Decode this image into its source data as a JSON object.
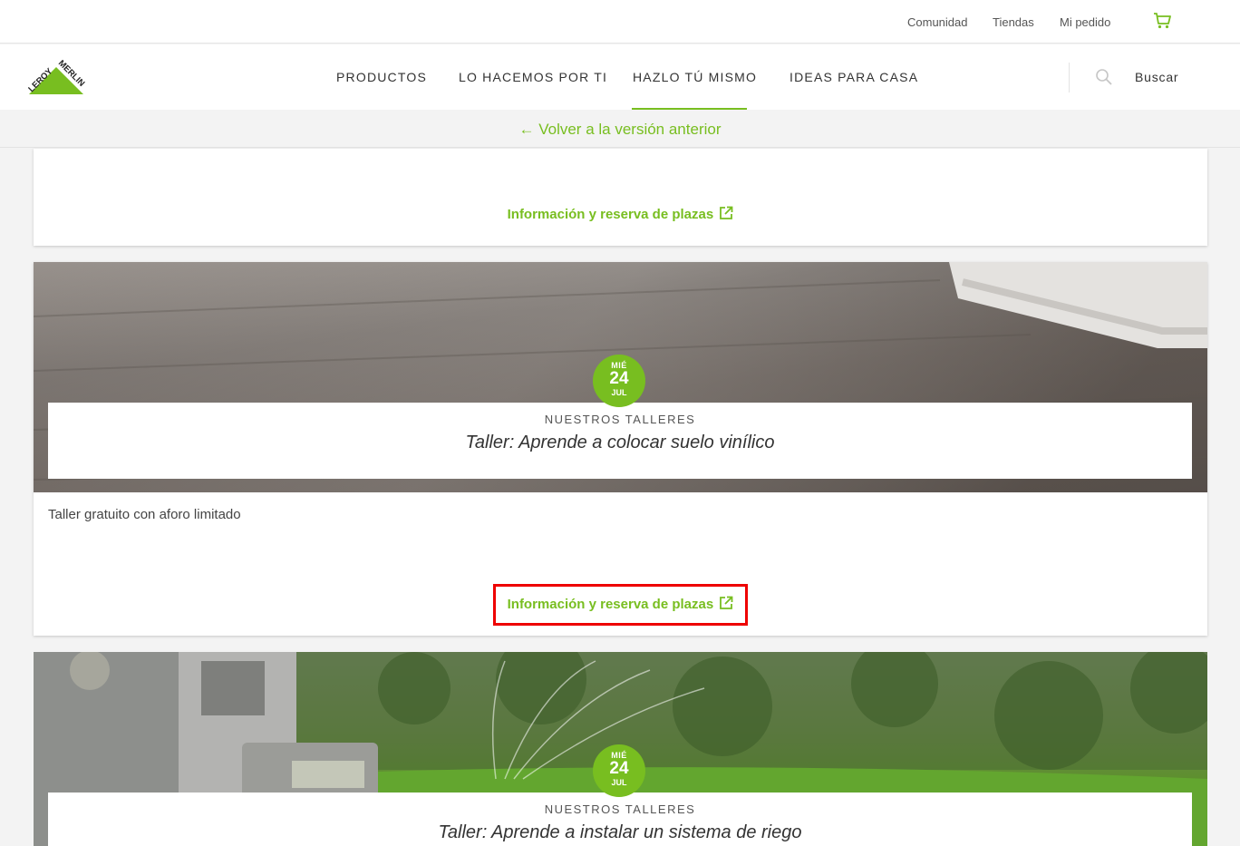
{
  "utility_nav": {
    "community": "Comunidad",
    "stores": "Tiendas",
    "my_order": "Mi pedido"
  },
  "brand": {
    "logo_text_1": "LEROY",
    "logo_text_2": "MERLIN",
    "color": "#78be20"
  },
  "main_nav": {
    "products": "PRODUCTOS",
    "we_do_it": "LO HACEMOS POR TI",
    "diy": "HAZLO TÚ MISMO",
    "ideas": "IDEAS PARA CASA",
    "active": "HAZLO TÚ MISMO"
  },
  "search": {
    "label": "Buscar"
  },
  "back_link": "← Volver a la versión anterior",
  "cards": [
    {
      "link_label": "Información y reserva de plazas"
    },
    {
      "day_name": "MIÉ",
      "day": "24",
      "month": "JUL",
      "category": "NUESTROS TALLERES",
      "title": "Taller: Aprende a colocar suelo vinílico",
      "description": "Taller gratuito con aforo limitado",
      "link_label": "Información y reserva de plazas"
    },
    {
      "day_name": "MIÉ",
      "day": "24",
      "month": "JUL",
      "category": "NUESTROS TALLERES",
      "title": "Taller: Aprende a instalar un sistema de riego"
    }
  ]
}
